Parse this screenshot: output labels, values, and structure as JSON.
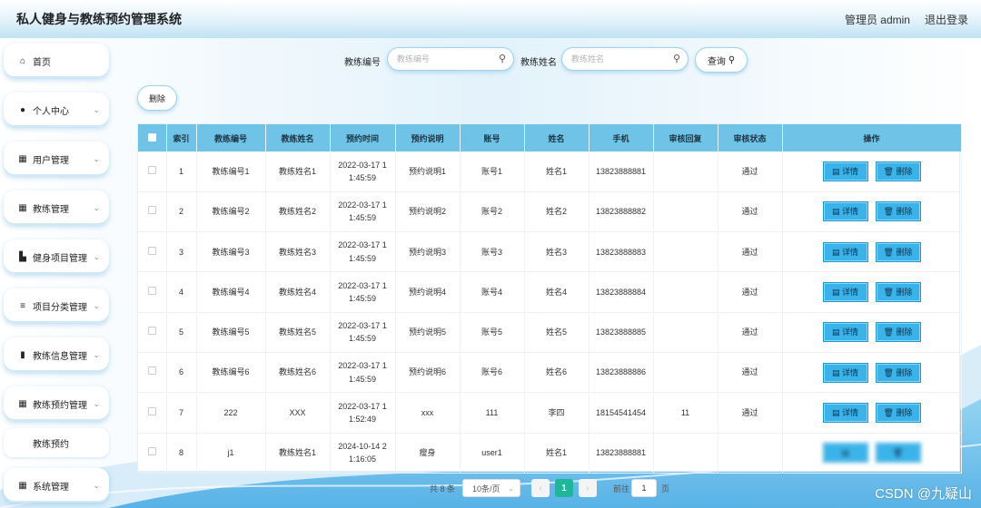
{
  "header": {
    "title": "私人健身与教练预约管理系统",
    "user": "管理员 admin",
    "logout": "退出登录"
  },
  "sidebar": {
    "items": [
      {
        "icon": "home-icon",
        "glyph": "⌂",
        "label": "首页",
        "chevron": false
      },
      {
        "icon": "user-icon",
        "glyph": "●",
        "label": "个人中心",
        "chevron": true
      },
      {
        "icon": "grid-icon",
        "glyph": "▦",
        "label": "用户管理",
        "chevron": true
      },
      {
        "icon": "grid-icon",
        "glyph": "▦",
        "label": "教练管理",
        "chevron": true
      },
      {
        "icon": "thumb-icon",
        "glyph": "▙",
        "label": "健身项目管理",
        "chevron": true
      },
      {
        "icon": "list-icon",
        "glyph": "≡",
        "label": "项目分类管理",
        "chevron": true
      },
      {
        "icon": "bar-icon",
        "glyph": "▮",
        "label": "教练信息管理",
        "chevron": true
      },
      {
        "icon": "grid-icon",
        "glyph": "▦",
        "label": "教练预约管理",
        "chevron": true
      },
      {
        "icon": "grid-icon",
        "glyph": "▦",
        "label": "系统管理",
        "chevron": true
      }
    ],
    "sub_item": "教练预约"
  },
  "search": {
    "coach_no_label": "教练编号",
    "coach_no_placeholder": "教练编号",
    "coach_name_label": "教练姓名",
    "coach_name_placeholder": "教练姓名",
    "query_button": "查询"
  },
  "toolbar": {
    "delete_label": "删除"
  },
  "table": {
    "headers": [
      "",
      "索引",
      "教练编号",
      "教练姓名",
      "预约时间",
      "预约说明",
      "账号",
      "姓名",
      "手机",
      "审核回复",
      "审核状态",
      "操作"
    ],
    "rows": [
      {
        "index": "1",
        "coach_no": "教练编号1",
        "coach_name": "教练姓名1",
        "time_line1": "2022-03-17 1",
        "time_line2": "1:45:59",
        "note": "预约说明1",
        "account": "账号1",
        "name": "姓名1",
        "phone": "13823888881",
        "reply": "",
        "status": "通过",
        "detail": "详情",
        "delete": "删除"
      },
      {
        "index": "2",
        "coach_no": "教练编号2",
        "coach_name": "教练姓名2",
        "time_line1": "2022-03-17 1",
        "time_line2": "1:45:59",
        "note": "预约说明2",
        "account": "账号2",
        "name": "姓名2",
        "phone": "13823888882",
        "reply": "",
        "status": "通过",
        "detail": "详情",
        "delete": "删除"
      },
      {
        "index": "3",
        "coach_no": "教练编号3",
        "coach_name": "教练姓名3",
        "time_line1": "2022-03-17 1",
        "time_line2": "1:45:59",
        "note": "预约说明3",
        "account": "账号3",
        "name": "姓名3",
        "phone": "13823888883",
        "reply": "",
        "status": "通过",
        "detail": "详情",
        "delete": "删除"
      },
      {
        "index": "4",
        "coach_no": "教练编号4",
        "coach_name": "教练姓名4",
        "time_line1": "2022-03-17 1",
        "time_line2": "1:45:59",
        "note": "预约说明4",
        "account": "账号4",
        "name": "姓名4",
        "phone": "13823888884",
        "reply": "",
        "status": "通过",
        "detail": "详情",
        "delete": "删除"
      },
      {
        "index": "5",
        "coach_no": "教练编号5",
        "coach_name": "教练姓名5",
        "time_line1": "2022-03-17 1",
        "time_line2": "1:45:59",
        "note": "预约说明5",
        "account": "账号5",
        "name": "姓名5",
        "phone": "13823888885",
        "reply": "",
        "status": "通过",
        "detail": "详情",
        "delete": "删除"
      },
      {
        "index": "6",
        "coach_no": "教练编号6",
        "coach_name": "教练姓名6",
        "time_line1": "2022-03-17 1",
        "time_line2": "1:45:59",
        "note": "预约说明6",
        "account": "账号6",
        "name": "姓名6",
        "phone": "13823888886",
        "reply": "",
        "status": "通过",
        "detail": "详情",
        "delete": "删除"
      },
      {
        "index": "7",
        "coach_no": "222",
        "coach_name": "XXX",
        "time_line1": "2022-03-17 1",
        "time_line2": "1:52:49",
        "note": "xxx",
        "account": "111",
        "name": "李四",
        "phone": "18154541454",
        "reply": "11",
        "status": "通过",
        "detail": "详情",
        "delete": "删除"
      },
      {
        "index": "8",
        "coach_no": "j1",
        "coach_name": "教练姓名1",
        "time_line1": "2024-10-14 2",
        "time_line2": "1:16:05",
        "note": "瘦身",
        "account": "user1",
        "name": "姓名1",
        "phone": "13823888881",
        "reply": "",
        "status": "",
        "detail": "",
        "delete": ""
      }
    ]
  },
  "pagination": {
    "total": "共 8 条",
    "page_size": "10条/页",
    "prev": "‹",
    "current": "1",
    "next": "›",
    "goto_label": "前往",
    "goto_value": "1",
    "page_suffix": "页"
  },
  "watermark": "CSDN @九疑山",
  "colors": {
    "header_row": "#6ec3e7",
    "op_button": "#3ab3ea",
    "current_page": "#1fb79a"
  }
}
